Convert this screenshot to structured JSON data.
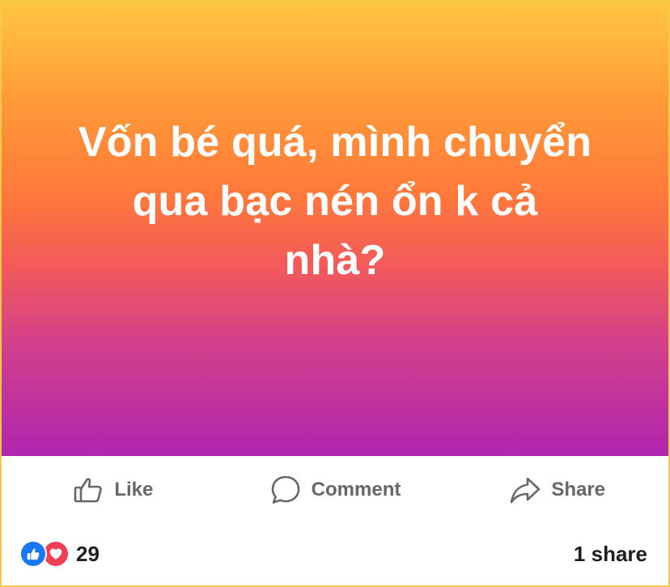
{
  "post": {
    "text": "Vốn bé quá, mình chuyển qua bạc nén ổn k cả nhà?",
    "gradient_top": "#ffc642",
    "gradient_bottom": "#b026b0"
  },
  "actions": {
    "like_label": "Like",
    "comment_label": "Comment",
    "share_label": "Share",
    "like_icon": "thumbs-up-icon",
    "comment_icon": "speech-bubble-icon",
    "share_icon": "share-arrow-icon"
  },
  "stats": {
    "reaction_icons": [
      "like-reaction-icon",
      "love-reaction-icon"
    ],
    "reaction_count": "29",
    "share_count": "1 share"
  },
  "colors": {
    "action_text": "#65676b",
    "like_blue": "#1877f2",
    "love_red": "#f33e58",
    "frame_border": "#f7c948"
  }
}
